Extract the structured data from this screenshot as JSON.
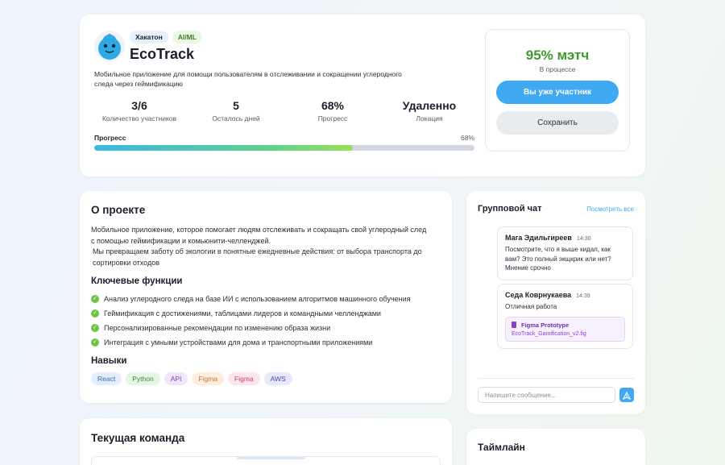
{
  "project": {
    "tags": [
      {
        "label": "Хакатон"
      },
      {
        "label": "AI/ML"
      }
    ],
    "title": "EcoTrack",
    "description": "Мобильное приложение для помощи пользователям в отслеживании и сокращении углеродного следа через геймификацию",
    "stats": [
      {
        "value": "3/6",
        "label": "Количество участников"
      },
      {
        "value": "5",
        "label": "Осталось дней"
      },
      {
        "value": "68%",
        "label": "Прогресс"
      },
      {
        "value": "Удаленно",
        "label": "Локация"
      }
    ],
    "progress": {
      "label": "Прогресс",
      "value_text": "68%",
      "value": 68
    }
  },
  "match": {
    "value": "95% мэтч",
    "status": "В процессе",
    "primary_button": "Вы уже участник",
    "secondary_button": "Сохранить"
  },
  "about": {
    "heading": "О проекте",
    "text_line1": "Мобильное приложение, которое помогает людям отслеживать и сокращать свой углеродный след с помощью геймификации и комьюнити-челленджей.",
    "text_line2": "Мы превращаем заботу об экологии в понятные ежедневные действия: от выбора транспорта до сортировки отходов",
    "features_heading": "Ключевые функции",
    "features": [
      "Анализ углеродного следа на базе ИИ с использованием алгоритмов машинного обучения",
      "Геймификация с достижениями, таблицами лидеров и командными челленджами",
      "Персонализированные рекомендации по изменению образа жизни",
      "Интеграция с умными устройствами для дома и транспортными приложениями"
    ],
    "skills_heading": "Навыки",
    "skills": [
      {
        "label": "React",
        "bg": "#e4eefb",
        "fg": "#2f6fb8"
      },
      {
        "label": "Python",
        "bg": "#e4f6e4",
        "fg": "#3a8a3a"
      },
      {
        "label": "API",
        "bg": "#efe6fb",
        "fg": "#7a3fc4"
      },
      {
        "label": "Figma",
        "bg": "#fdeedd",
        "fg": "#c0782a"
      },
      {
        "label": "Figma",
        "bg": "#fbe6ee",
        "fg": "#c43f6f"
      },
      {
        "label": "AWS",
        "bg": "#e9e8fb",
        "fg": "#4a47b8"
      }
    ]
  },
  "chat": {
    "title": "Групповой чат",
    "view_all": "Посмотреть все",
    "messages": [
      {
        "author": "Мага Эдильгиреев",
        "time": "14:30",
        "text": "Посмотрите, что я выше кидал, как вам? Это полный экщкрик или нет? Мнение срочно"
      },
      {
        "author": "Седа Коврнукаева",
        "time": "14:39",
        "text": "Отличная работа",
        "attachment": {
          "name": "Figma Prototype",
          "file": "EcoTrack_Gamification_v2.fig"
        }
      }
    ],
    "input_placeholder": "Напишите сообщение...",
    "send_icon": "send-icon"
  },
  "team": {
    "heading": "Текущая команда"
  },
  "timeline": {
    "heading": "Таймлайн"
  },
  "colors": {
    "accent": "#3fa9f2",
    "match": "#3a9a2a",
    "check": "#6cc644"
  }
}
